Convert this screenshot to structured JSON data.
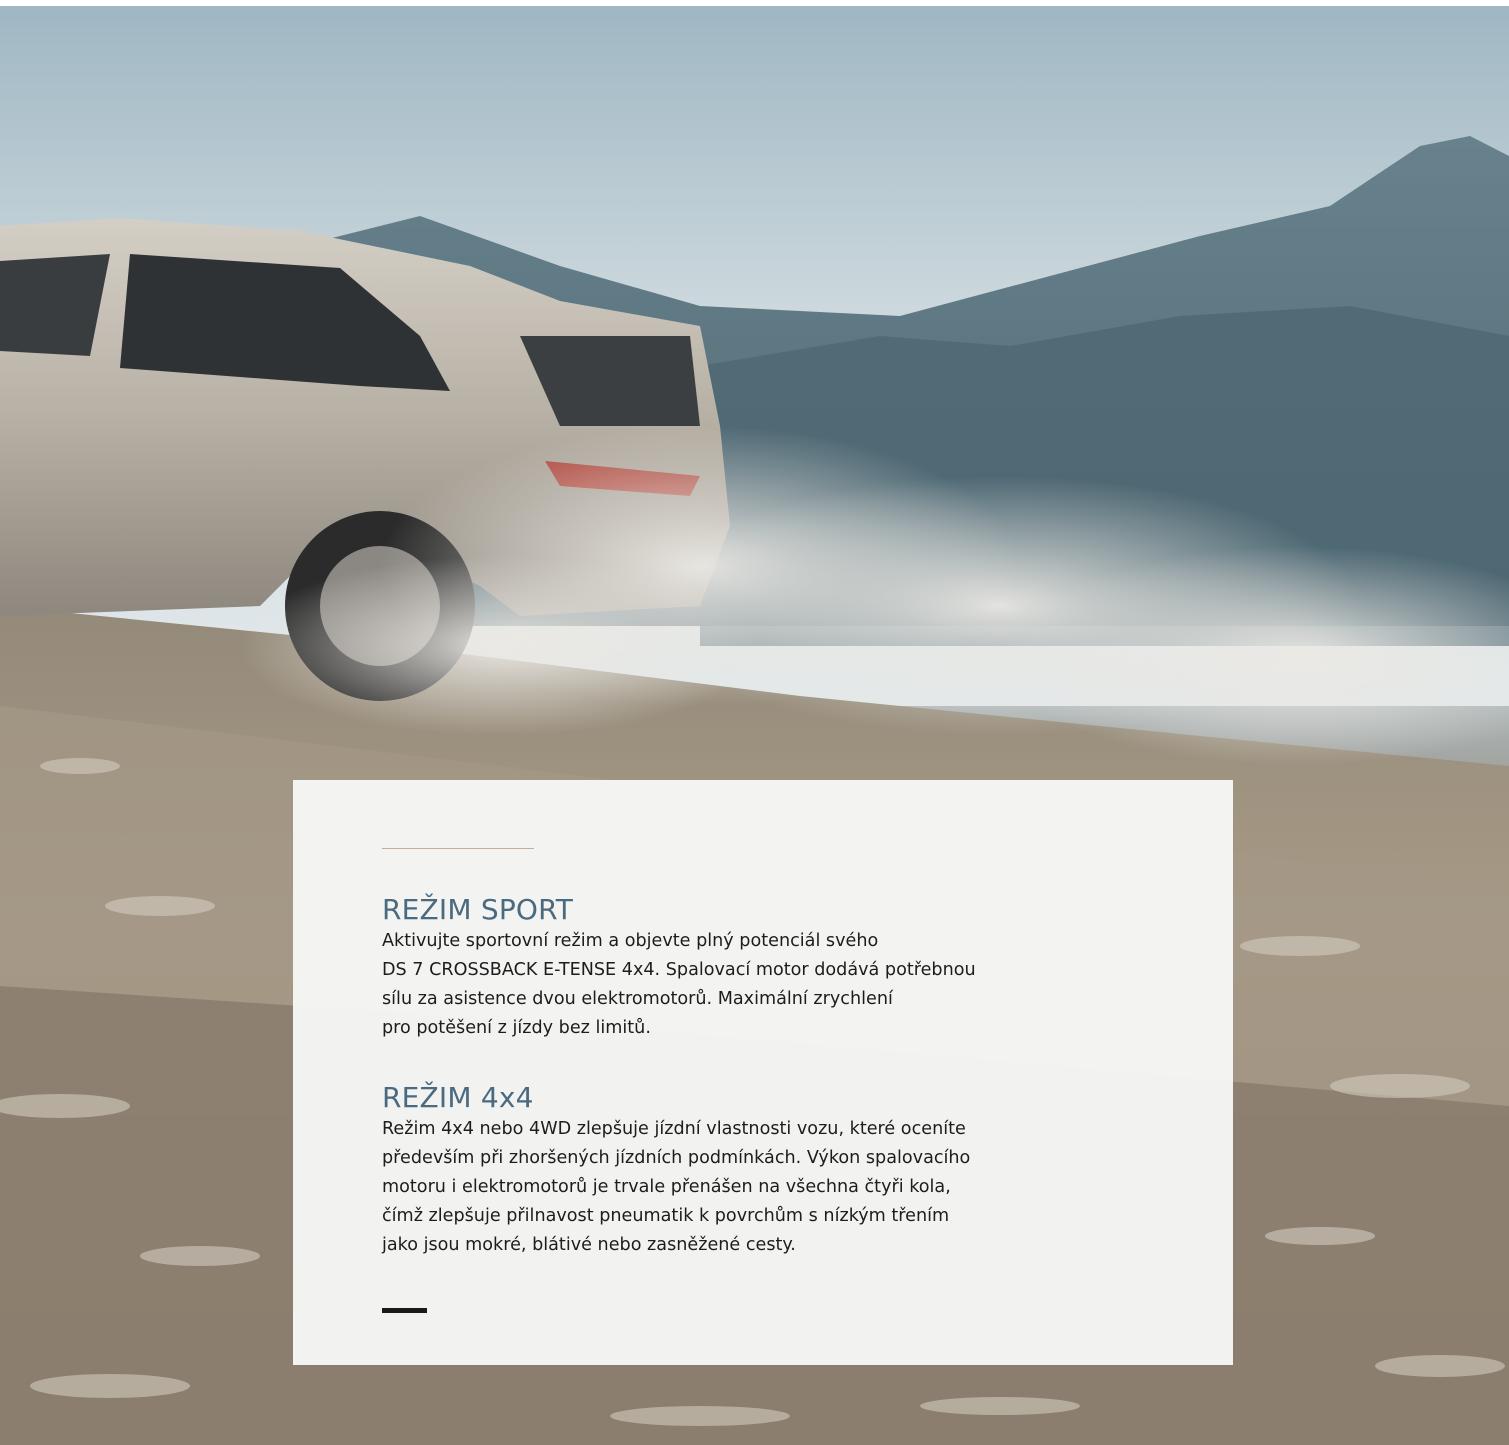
{
  "hero": {
    "image": "hero-photo-suv-driving-on-dusty-mountain-slope"
  },
  "colors": {
    "title": "#4a6a80",
    "accent_line": "#c9ab94",
    "body_text": "#1d1d1d",
    "card_bg": "#f6f6f6",
    "closing_bar": "#1a1a1a"
  },
  "sections": [
    {
      "title": "REŽIM SPORT",
      "body": "Aktivujte sportovní režim a objevte plný potenciál svého\nDS 7 CROSSBACK E-TENSE 4x4. Spalovací motor dodává potřebnou\nsílu za asistence dvou elektromotorů. Maximální zrychlení\npro potěšení z jízdy bez limitů."
    },
    {
      "title": "REŽIM 4x4",
      "body": "Režim 4x4 nebo 4WD zlepšuje jízdní vlastnosti vozu, které oceníte\npředevším při zhoršených jízdních podmínkách. Výkon spalovacího\nmotoru i elektromotorů je trvale přenášen na všechna čtyři kola,\nčímž zlepšuje přilnavost pneumatik k povrchům s nízkým třením\njako jsou mokré, blátivé nebo zasněžené cesty."
    }
  ]
}
